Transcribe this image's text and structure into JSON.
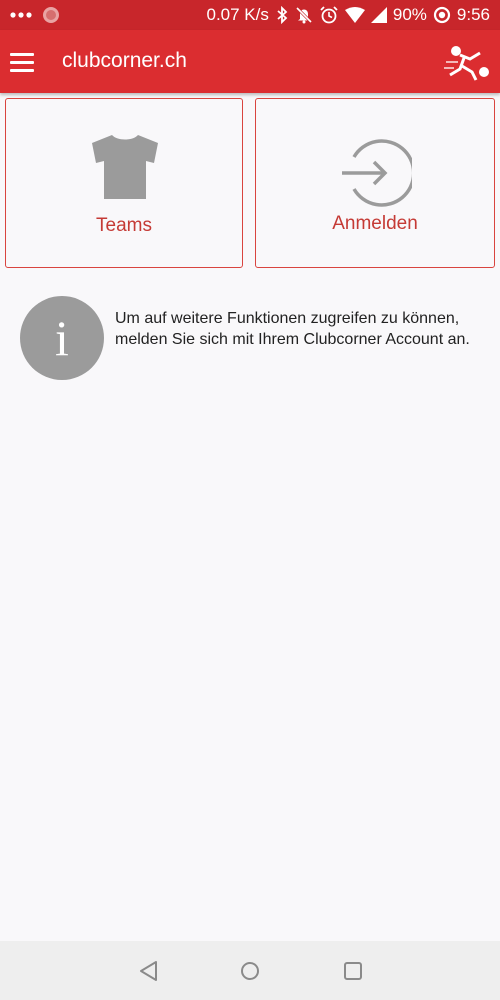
{
  "status_bar": {
    "network_speed": "0.07 K/s",
    "battery": "90%",
    "time": "9:56"
  },
  "app_bar": {
    "title": "clubcorner.ch",
    "menu_icon": "menu-icon",
    "logo": "sfv-logo"
  },
  "tiles": {
    "teams_label": "Teams",
    "teams_icon": "tshirt-icon",
    "login_label": "Anmelden",
    "login_icon": "login-icon"
  },
  "info": {
    "icon_letter": "i",
    "text": "Um auf weitere Funktionen zugreifen zu können, melden Sie sich mit Ihrem Clubcorner Account an."
  },
  "colors": {
    "status_bar": "#c8262b",
    "app_bar": "#db2d30",
    "accent_text": "#c53a35",
    "tile_border": "#d9443f",
    "icon_gray": "#9b9b9b",
    "background": "#f9f8fa"
  }
}
